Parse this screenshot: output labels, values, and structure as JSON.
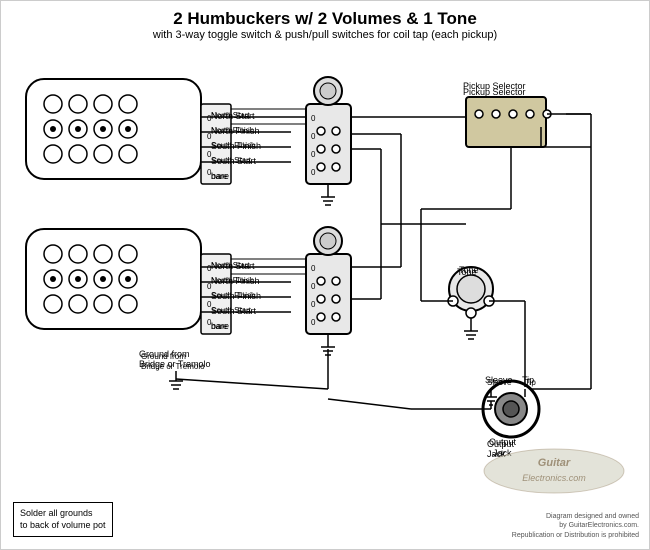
{
  "header": {
    "title": "2 Humbuckers w/ 2 Volumes & 1 Tone",
    "subtitle": "with 3-way toggle switch & push/pull switches for coil tap (each pickup)"
  },
  "labels": {
    "north_start": "North Start",
    "north_finish": "North Finish",
    "south_finish": "South Finish",
    "south_start": "South Start",
    "bare": "bare",
    "ground_bridge": "Ground from\nBridge or Tremolo",
    "pickup_selector": "Pickup Selector",
    "tone": "Tone",
    "sleeve": "Sleeve",
    "tip": "Tip",
    "output_jack": "Output\nJack",
    "note": "Solder all grounds\nto back of volume pot"
  },
  "copyright": {
    "line1": "Diagram designed and owned",
    "line2": "by GuitarElectronics.com.",
    "line3": "Republication or Distribution is prohibited"
  },
  "watermark": "GuitarElectronics.com"
}
